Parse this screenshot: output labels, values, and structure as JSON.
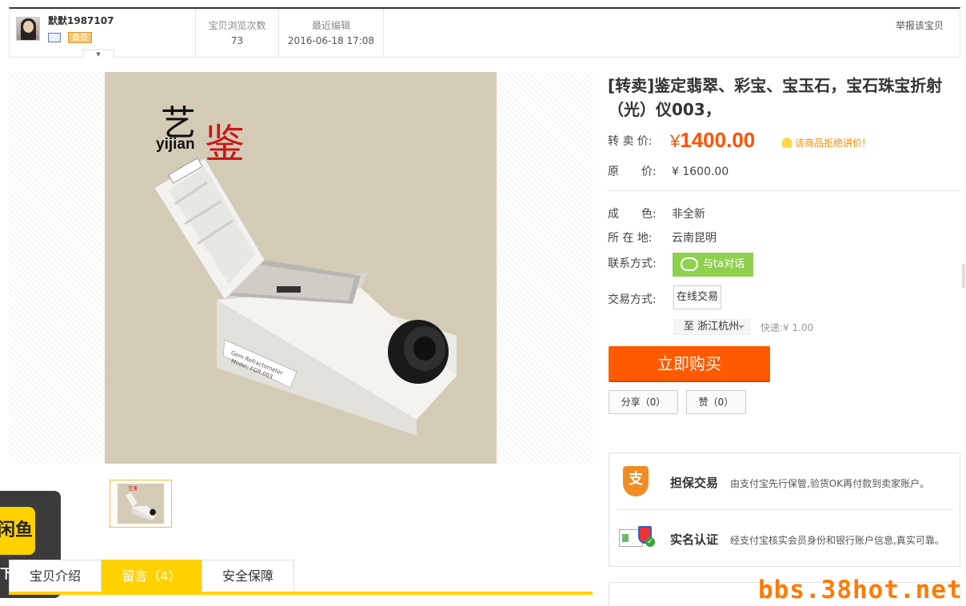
{
  "seller": {
    "username": "默默1987107",
    "member_badge": "会员"
  },
  "stats": {
    "views_label": "宝贝浏览次数",
    "views_value": "73",
    "edited_label": "最近编辑",
    "edited_value": "2016-06-18 17:08"
  },
  "report_label": "举报该宝贝",
  "product": {
    "title": "[转卖]鉴定翡翠、彩宝、宝玉石，宝石珠宝折射（光）仪003，",
    "image_logo_cn_1": "艺",
    "image_logo_cn_2": "鉴",
    "image_logo_en": "yijian",
    "resale_price_label": "转 卖 价:",
    "resale_price_symbol": "¥",
    "resale_price": "1400.00",
    "price_tip": "该商品拒绝讲价!",
    "original_price_label": "原　　价:",
    "original_price": "¥ 1600.00",
    "condition_label": "成　　色:",
    "condition": "非全新",
    "location_label": "所 在 地:",
    "location": "云南昆明",
    "contact_label": "联系方式:",
    "contact_button": "与ta对话",
    "trade_label": "交易方式:",
    "trade_option": "在线交易",
    "destination": "至 浙江杭州",
    "shipping": "快递:¥ 1.00",
    "buy_button": "立即购买",
    "share_button": "分享（0）",
    "like_button": "赞（0）"
  },
  "guarantees": [
    {
      "title": "担保交易",
      "desc": "由支付宝先行保管,验货OK再付款到卖家账户。",
      "icon": "alipay-shield-icon"
    },
    {
      "title": "实名认证",
      "desc": "经支付宝核实会员身份和银行账户信息,真实可靠。",
      "icon": "id-verified-icon"
    }
  ],
  "tabs": [
    {
      "label": "宝贝介绍"
    },
    {
      "label": "留言（4）"
    },
    {
      "label": "安全保障"
    }
  ],
  "xianyu": {
    "icon_text": "闲鱼",
    "label": "下载闲鱼"
  },
  "watermark": "bbs.38hot.net",
  "colors": {
    "accent": "#ff5a00",
    "tab_active": "#ffd200",
    "chat": "#8fd14f"
  }
}
